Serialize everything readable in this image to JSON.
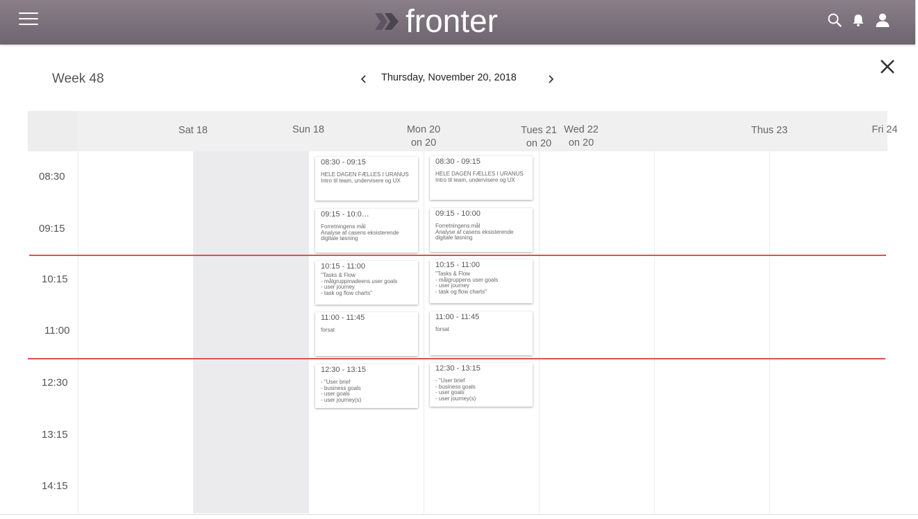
{
  "app": {
    "logo_text": "fronter"
  },
  "header": {
    "week": "Week 48",
    "date": "Thursday, November 20, 2018"
  },
  "days": [
    {
      "l1": "Sat 18",
      "l2": ""
    },
    {
      "l1": "Sun 18",
      "l2": ""
    },
    {
      "l1": "Mon 20",
      "l2": "on 20"
    },
    {
      "l1": "Tues 21",
      "l2": "on 20"
    },
    {
      "l1": "Wed 22",
      "l2": "on 20"
    },
    {
      "l1": "Thus 23",
      "l2": ""
    },
    {
      "l1": "Fri 24",
      "l2": ""
    }
  ],
  "times": [
    "08:30",
    "09:15",
    "10:15",
    "11:00",
    "12:30",
    "13:15",
    "14:15"
  ],
  "events": {
    "mon": [
      {
        "time": "08:30 - 09:15",
        "body": "HELE DAGEN FÆLLES I URANUS\nIntro til team, undervisere og UX"
      },
      {
        "time": "09:15 - 10:0…",
        "body": "Forretningens mål\nAnalyse af casens eksisterende\ndigitale løsning"
      },
      {
        "time": "10:15 - 11:00",
        "body": "\"Tasks & Flow\n - målgruppmadeens user goals\n - user journey\n - task og flow charts\""
      },
      {
        "time": "11:00 - 11:45",
        "body": " forsat"
      },
      {
        "time": "12:30 - 13:15",
        "body": "- \"User brief\n - business goals\n - user goals\n - user journey(s)"
      }
    ],
    "tue": [
      {
        "time": "08:30 - 09:15",
        "body": "HELE DAGEN FÆLLES I URANUS\nIntro til team, undervisere og UX"
      },
      {
        "time": "09:15 - 10:00",
        "body": "Forretningens mål\nAnalyse af casens eksisterende\ndigitale løsning"
      },
      {
        "time": "10:15 - 11:00",
        "body": "\"Tasks & Flow\n - målgruppens user goals\n - user journey\n - task og flow charts\""
      },
      {
        "time": "11:00 - 11:45",
        "body": " forsat"
      },
      {
        "time": "12:30 - 13:15",
        "body": "- \"User brief\n - business goals\n - user goals\n - user journey(s)"
      }
    ]
  },
  "icons": [
    "menu-icon",
    "search-icon",
    "bell-icon",
    "user-icon",
    "chevron-left-icon",
    "chevron-right-icon",
    "close-icon"
  ],
  "colors": {
    "topbar": "#7a7079",
    "current_time_line": "#e05050",
    "sunday_shade": "#ebebed"
  }
}
